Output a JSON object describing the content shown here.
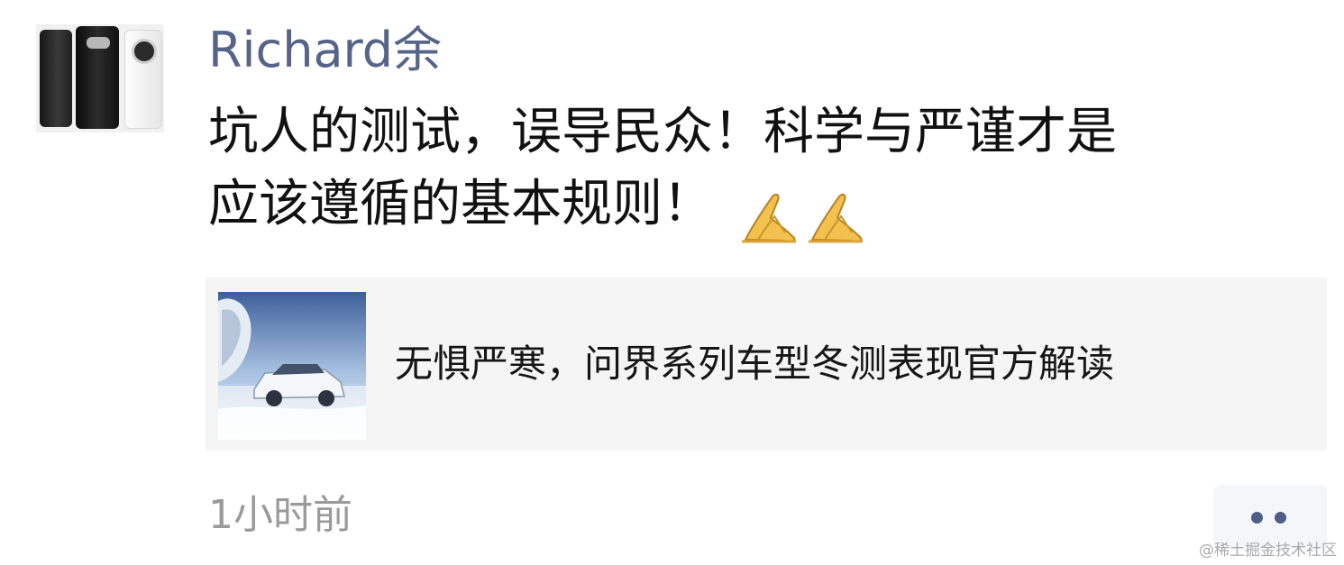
{
  "post": {
    "author": "Richard余",
    "text_line_1": "坑人的测试，误导民众！科学与严谨才是",
    "text_line_2": "应该遵循的基本规则！",
    "emoji": [
      "folded-hands",
      "folded-hands"
    ],
    "timestamp": "1小时前"
  },
  "link_card": {
    "title": "无惧严寒，问界系列车型冬测表现官方解读"
  },
  "watermark": "@稀土掘金技术社区",
  "colors": {
    "author_name": "#56648a",
    "body_text": "#111111",
    "card_background": "#f5f5f5",
    "timestamp": "#9a9a9a",
    "more_dots": "#4f5e86"
  }
}
